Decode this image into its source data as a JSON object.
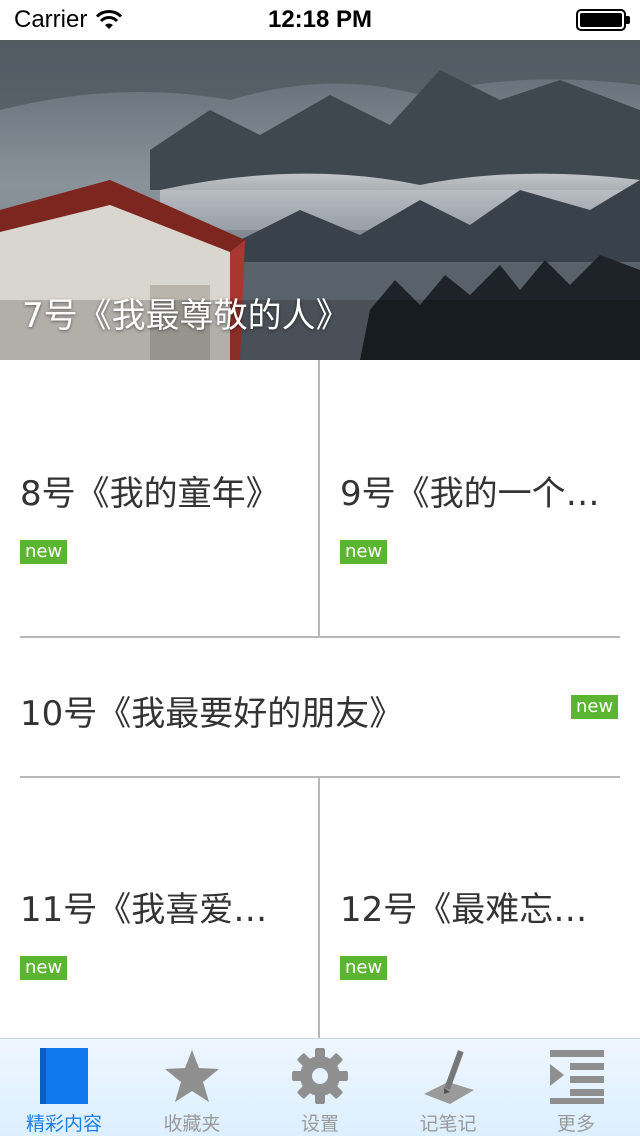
{
  "status_bar": {
    "carrier": "Carrier",
    "time": "12:18 PM"
  },
  "hero": {
    "title": "7号《我最尊敬的人》"
  },
  "items": [
    {
      "title": "8号《我的童年》",
      "badge": "new"
    },
    {
      "title": "9号《我的一个…",
      "badge": "new"
    },
    {
      "title": "10号《我最要好的朋友》",
      "badge": "new"
    },
    {
      "title": "11号《我喜爱…",
      "badge": "new"
    },
    {
      "title": "12号《最难忘…",
      "badge": "new"
    }
  ],
  "tabs": [
    {
      "label": "精彩内容",
      "icon": "book-icon",
      "active": true
    },
    {
      "label": "收藏夹",
      "icon": "star-icon",
      "active": false
    },
    {
      "label": "设置",
      "icon": "gear-icon",
      "active": false
    },
    {
      "label": "记笔记",
      "icon": "pen-icon",
      "active": false
    },
    {
      "label": "更多",
      "icon": "more-list-icon",
      "active": false
    }
  ],
  "colors": {
    "accent": "#1e7fe0",
    "badge": "#5cb531",
    "divider": "#b8b8b8",
    "tab_inactive": "#9a9a9a"
  }
}
